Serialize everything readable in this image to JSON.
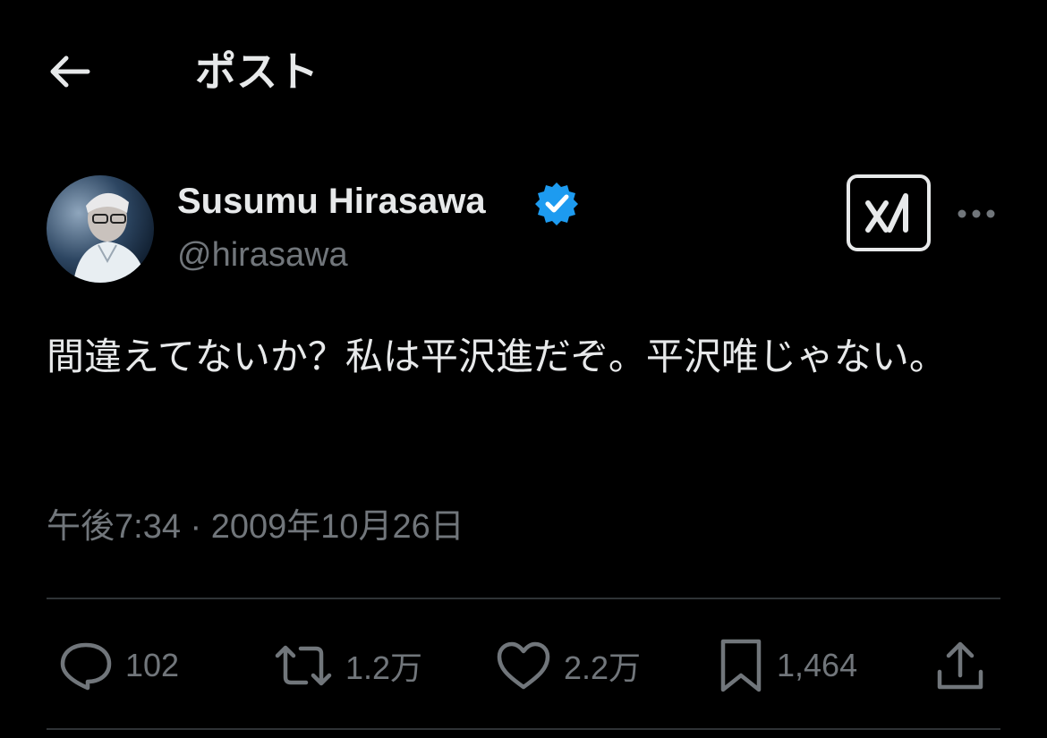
{
  "header": {
    "title": "ポスト"
  },
  "author": {
    "name": "Susumu Hirasawa",
    "handle": "@hirasawa"
  },
  "post": {
    "text": "間違えてないか？私は平沢進だぞ。平沢唯じゃない。",
    "timestamp": "午後7:34 · 2009年10月26日"
  },
  "actions": {
    "replies": "102",
    "reposts": "1.2万",
    "likes": "2.2万",
    "bookmarks": "1,464"
  },
  "colors": {
    "background": "#000000",
    "text_primary": "#e7e9ea",
    "text_secondary": "#71767b",
    "verified_blue": "#1d9bf0",
    "divider": "#2f3336"
  },
  "icons": {
    "back": "arrow-left-icon",
    "verified": "verified-badge-icon",
    "grok": "grok-icon",
    "more": "more-horizontal-icon",
    "reply": "comment-icon",
    "repost": "repost-icon",
    "like": "heart-icon",
    "bookmark": "bookmark-icon",
    "share": "share-icon"
  }
}
